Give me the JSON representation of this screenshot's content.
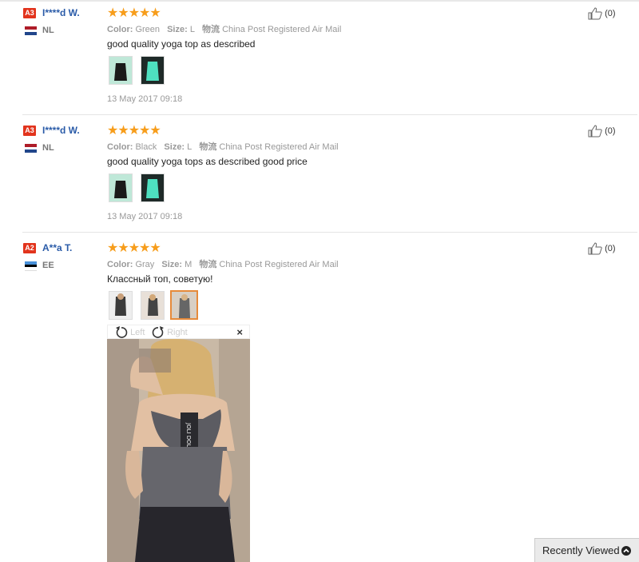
{
  "reviews": [
    {
      "level": "A3",
      "user": "I****d W.",
      "country": "NL",
      "stars": "★★★★★",
      "color_label": "Color:",
      "color_value": "Green",
      "size_label": "Size:",
      "size_value": "L",
      "ship_label": "物流",
      "ship_value": "China Post Registered Air Mail",
      "text": "good quality yoga top as described",
      "date": "13 May 2017 09:18",
      "helpful": "(0)"
    },
    {
      "level": "A3",
      "user": "I****d W.",
      "country": "NL",
      "stars": "★★★★★",
      "color_label": "Color:",
      "color_value": "Black",
      "size_label": "Size:",
      "size_value": "L",
      "ship_label": "物流",
      "ship_value": "China Post Registered Air Mail",
      "text": "good quality yoga tops as described good price",
      "date": "13 May 2017 09:18",
      "helpful": "(0)"
    },
    {
      "level": "A2",
      "user": "A**a T.",
      "country": "EE",
      "stars": "★★★★★",
      "color_label": "Color:",
      "color_value": "Gray",
      "size_label": "Size:",
      "size_value": "M",
      "ship_label": "物流",
      "ship_value": "China Post Registered Air Mail",
      "text": "Классный топ, советую!",
      "helpful": "(0)"
    }
  ],
  "viewer": {
    "left_label": "Left",
    "right_label": "Right",
    "close": "×"
  },
  "recently_viewed": "Recently Viewed",
  "colors": {
    "star": "#f79d1b",
    "username": "#2a5ba8",
    "level_badge": "#e2341d",
    "selected_thumb": "#e68a3a"
  }
}
